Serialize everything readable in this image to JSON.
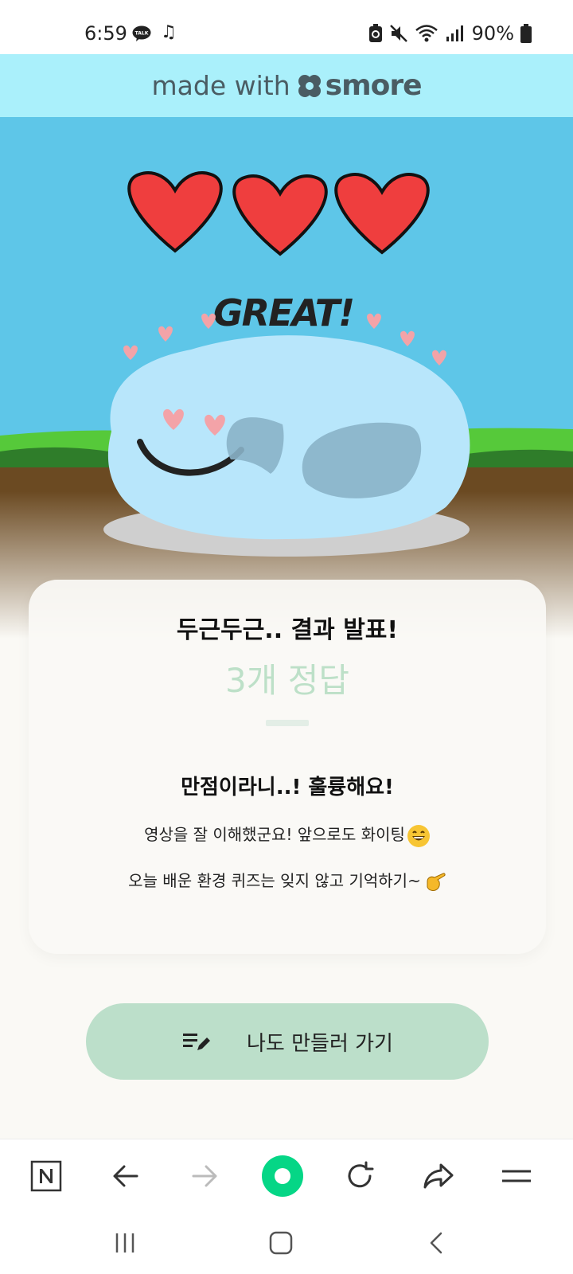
{
  "status_bar": {
    "time": "6:59",
    "talk_badge": "TALK",
    "battery": "90%"
  },
  "banner": {
    "made_with": "made with",
    "brand": "smore"
  },
  "hero": {
    "exclaim": "GREAT!",
    "hearts_count": 3
  },
  "result": {
    "heading": "두근두근.. 결과 발표!",
    "score": "3개 정답",
    "message_title": "만점이라니..! 훌륭해요!",
    "line1": "영상을 잘 이해했군요! 앞으로도 화이팅",
    "line2": "오늘 배운 환경 퀴즈는 잊지 않고 기억하기~"
  },
  "cta": {
    "label": "나도 만들러 가기"
  },
  "colors": {
    "banner_bg": "#aaf0fb",
    "sky": "#5ec6e8",
    "grass": "#56c93a",
    "soil": "#6b4a22",
    "heart": "#ef3e3e",
    "blob": "#b8e6fb",
    "score": "#bde0c8",
    "cta_bg": "#bcdfca",
    "naver_green": "#05d686"
  }
}
